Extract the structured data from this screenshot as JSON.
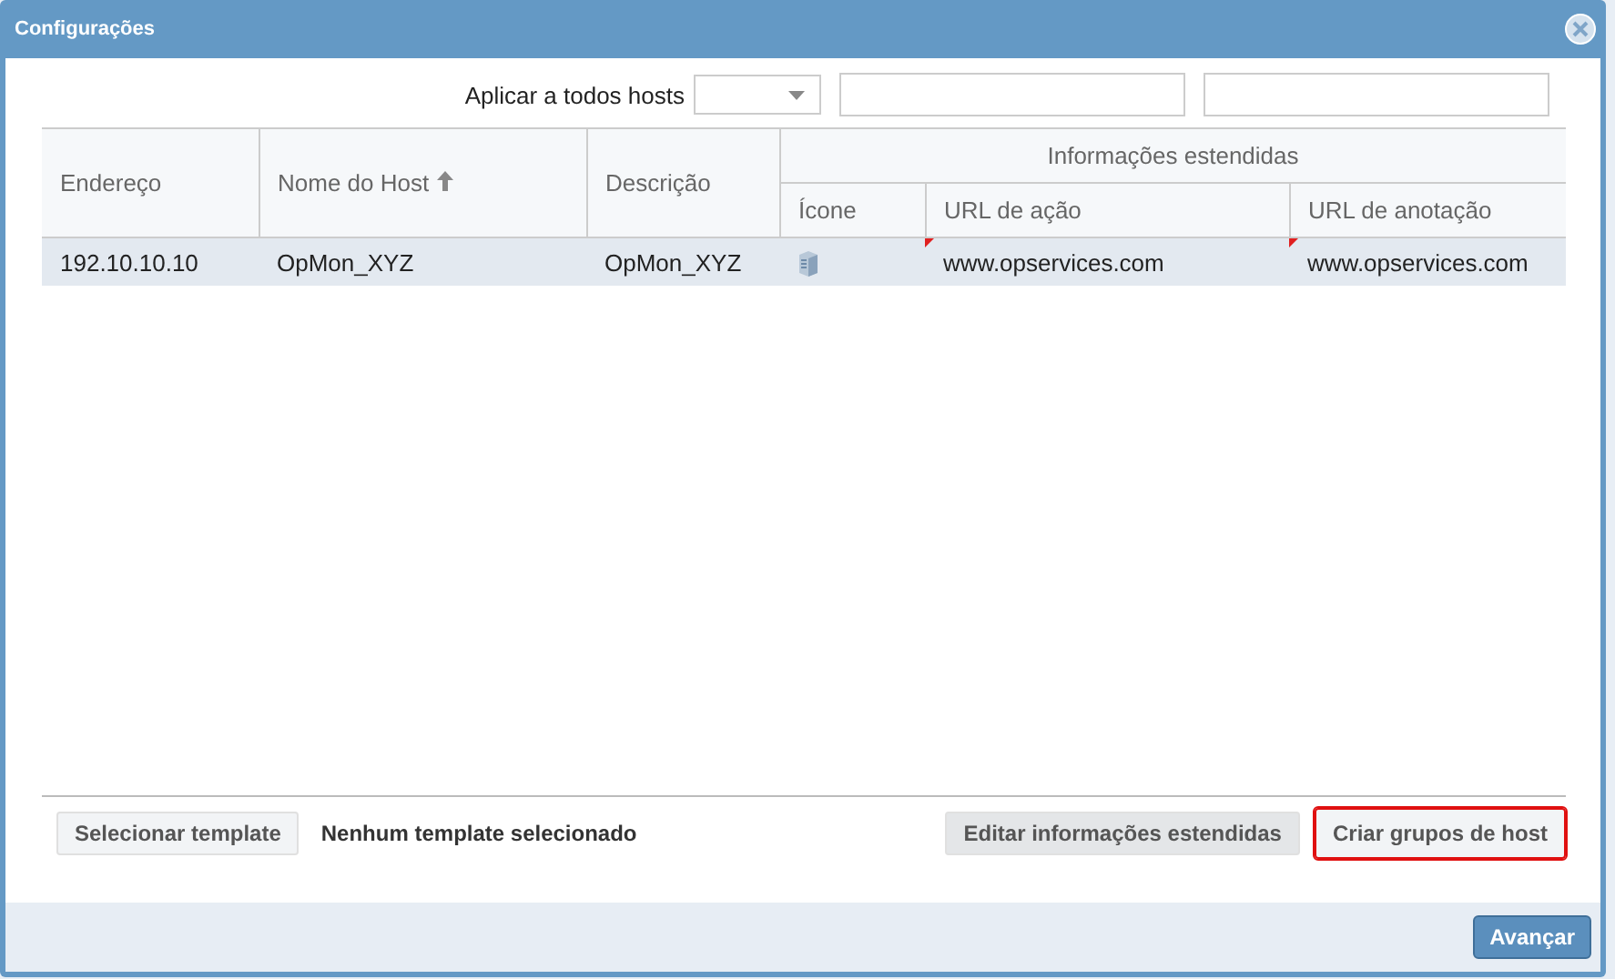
{
  "window": {
    "title": "Configurações"
  },
  "apply_all": {
    "label": "Aplicar a todos hosts"
  },
  "table": {
    "columns": [
      {
        "label": "Endereço",
        "sorted": false
      },
      {
        "label": "Nome do Host",
        "sorted": true
      },
      {
        "label": "Descrição",
        "sorted": false
      }
    ],
    "group": {
      "label": "Informações estendidas",
      "columns": [
        "Ícone",
        "URL de ação",
        "URL de anotação"
      ]
    },
    "rows": [
      {
        "selected": true,
        "address": "192.10.10.10",
        "host": "OpMon_XYZ",
        "description": "OpMon_XYZ",
        "action_url": {
          "text": "www.opservices.com",
          "modified": true
        },
        "notes_url": {
          "text": "www.opservices.com",
          "modified": true
        }
      }
    ]
  },
  "footer": {
    "select_template": {
      "label": "Selecionar template"
    },
    "template_status": "Nenhum template selecionado",
    "buttons": [
      {
        "label": "Editar informações estendidas",
        "highlighted": false
      },
      {
        "label": "Criar grupos de host",
        "highlighted": true
      }
    ]
  },
  "primary_button": "Avançar"
}
